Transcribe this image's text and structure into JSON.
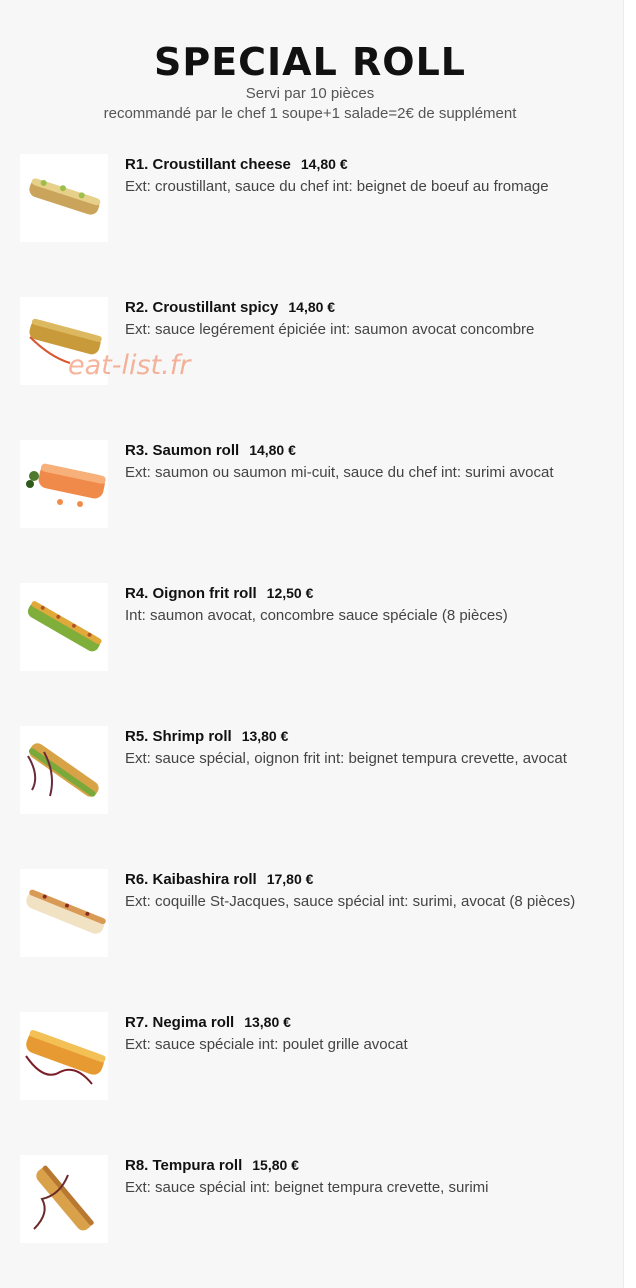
{
  "header": {
    "title": "SPECIAL ROLL",
    "subtitle_1": "Servi par 10 pièces",
    "subtitle_2": "recommandé par le chef 1 soupe+1 salade=2€ de supplément"
  },
  "watermark": "eat-list.fr",
  "items": [
    {
      "name": "R1. Croustillant cheese",
      "price": "14,80 €",
      "description": "Ext: croustillant, sauce du chef int: beignet de boeuf au fromage",
      "image_icon": "sushi-roll-icon"
    },
    {
      "name": "R2. Croustillant spicy",
      "price": "14,80 €",
      "description": "Ext: sauce legérement épiciée int: saumon avocat concombre",
      "image_icon": "sushi-roll-icon"
    },
    {
      "name": "R3. Saumon roll",
      "price": "14,80 €",
      "description": "Ext: saumon ou saumon mi-cuit, sauce du chef int: surimi avocat",
      "image_icon": "sushi-roll-icon"
    },
    {
      "name": "R4. Oignon frit roll",
      "price": "12,50 €",
      "description": "Int: saumon avocat, concombre sauce spéciale (8 pièces)",
      "image_icon": "sushi-roll-icon"
    },
    {
      "name": "R5. Shrimp roll",
      "price": "13,80 €",
      "description": "Ext: sauce spécial, oignon frit int: beignet tempura crevette, avocat",
      "image_icon": "sushi-roll-icon"
    },
    {
      "name": "R6. Kaibashira roll",
      "price": "17,80 €",
      "description": "Ext: coquille St-Jacques, sauce spécial int: surimi, avocat (8 pièces)",
      "image_icon": "sushi-roll-icon"
    },
    {
      "name": "R7. Negima roll",
      "price": "13,80 €",
      "description": "Ext: sauce spéciale int: poulet grille avocat",
      "image_icon": "sushi-roll-icon"
    },
    {
      "name": "R8. Tempura roll",
      "price": "15,80 €",
      "description": "Ext: sauce spécial int: beignet tempura crevette, surimi",
      "image_icon": "sushi-roll-icon"
    }
  ],
  "colors": {
    "background": "#f7f7f7",
    "title": "#111111",
    "watermark": "#f0825a"
  }
}
